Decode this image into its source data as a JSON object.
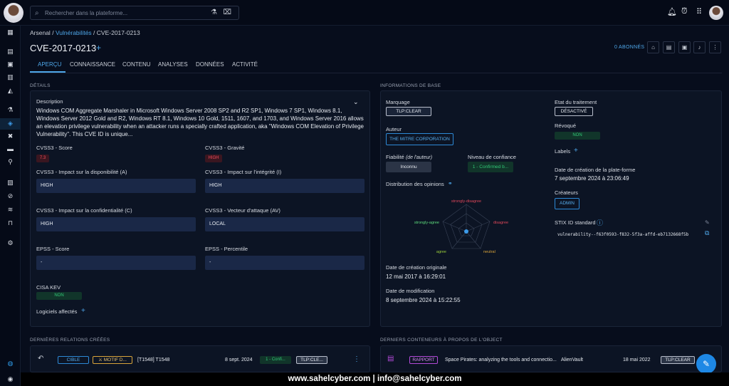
{
  "search": {
    "placeholder": "Rechercher dans la plateforme..."
  },
  "breadcrumb": {
    "root": "Arsenal",
    "sep1": "/",
    "section": "Vulnérabilités",
    "sep2": "/",
    "current": "CVE-2017-0213"
  },
  "entity": {
    "title": "CVE-2017-0213",
    "subscribers": "0 ABONNÉS"
  },
  "tabs": [
    "APERÇU",
    "CONNAISSANCE",
    "CONTENU",
    "ANALYSES",
    "DONNÉES",
    "ACTIVITÉ"
  ],
  "details": {
    "section_title": "DÉTAILS",
    "description_label": "Description",
    "description": "Windows COM Aggregate Marshaler in Microsoft Windows Server 2008 SP2 and R2 SP1, Windows 7 SP1, Windows 8.1, Windows Server 2012 Gold and R2, Windows RT 8.1, Windows 10 Gold, 1511, 1607, and 1703, and Windows Server 2016 allows an elevation privilege vulnerability when an attacker runs a specially crafted application, aka \"Windows COM Elevation of Privilege Vulnerability\". This CVE ID is unique...",
    "cvss_score_label": "CVSS3 - Score",
    "cvss_score": "7.3",
    "cvss_severity_label": "CVSS3 - Gravité",
    "cvss_severity": "HIGH",
    "avail_label": "CVSS3 - Impact sur la disponibilité (A)",
    "avail": "HIGH",
    "integrity_label": "CVSS3 - Impact sur l'intégrité (I)",
    "integrity": "HIGH",
    "conf_label": "CVSS3 - Impact sur la confidentialité (C)",
    "conf": "HIGH",
    "vector_label": "CVSS3 - Vecteur d'attaque (AV)",
    "vector": "LOCAL",
    "epss_score_label": "EPSS - Score",
    "epss_score": "-",
    "epss_pct_label": "EPSS - Percentile",
    "epss_pct": "-",
    "kev_label": "CISA KEV",
    "kev": "NON",
    "software_label": "Logiciels affectés"
  },
  "basic": {
    "section_title": "INFORMATIONS DE BASE",
    "marking_label": "Marquage",
    "marking": "TLP:CLEAR",
    "author_label": "Auteur",
    "author": "THE MITRE CORPORATION",
    "reliability_label": "Fiabilité",
    "reliability_hint": "(de l'auteur)",
    "reliability": "Inconnu",
    "confidence_label": "Niveau de confiance",
    "confidence": "1 - Confirmed b...",
    "opinions_label": "Distribution des opinions",
    "radar": {
      "labels": [
        "strongly-disagree",
        "disagree",
        "neutral",
        "agree",
        "strongly-agree"
      ],
      "values": [
        0,
        0,
        0,
        0,
        0
      ]
    },
    "orig_created_label": "Date de création originale",
    "orig_created": "12 mai 2017 à 16:29:01",
    "modified_label": "Date de modification",
    "modified": "8 septembre 2024 à 15:22:55",
    "status_label": "Etat du traitement",
    "status": "DÉSACTIVÉ",
    "revoked_label": "Révoqué",
    "revoked": "NON",
    "labels_label": "Labels",
    "platform_created_label": "Date de création de la plate-forme",
    "platform_created": "7 septembre 2024 à 23:06:49",
    "creators_label": "Créateurs",
    "creator": "ADMIN",
    "stix_label": "STIX ID standard",
    "stix": "vulnerability--f63f0593-f832-5f3a-affd-eb7132668f5b"
  },
  "relations": {
    "section_title": "DERNIÈRES RELATIONS CRÉÉES",
    "row": {
      "type": "CIBLE",
      "entity": "MOTIF D...",
      "name": "[T1548] T1548",
      "date": "8 sept. 2024",
      "confidence": "1 - Confi...",
      "marking": "TLP:CLE..."
    }
  },
  "containers": {
    "section_title": "DERNIERS CONTENEURS À PROPOS DE L'OBJECT",
    "row": {
      "type": "RAPPORT",
      "title": "Space Pirates: analyzing the tools and connectio...",
      "author": "AlienVault",
      "date": "18 mai 2022",
      "marking": "TLP:CLEAR"
    }
  },
  "footer": {
    "text": "www.sahelcyber.com | info@sahelcyber.com"
  },
  "colors": {
    "accent": "#4ea6e8",
    "high": "#ef4a5a",
    "ok": "#32c977"
  }
}
